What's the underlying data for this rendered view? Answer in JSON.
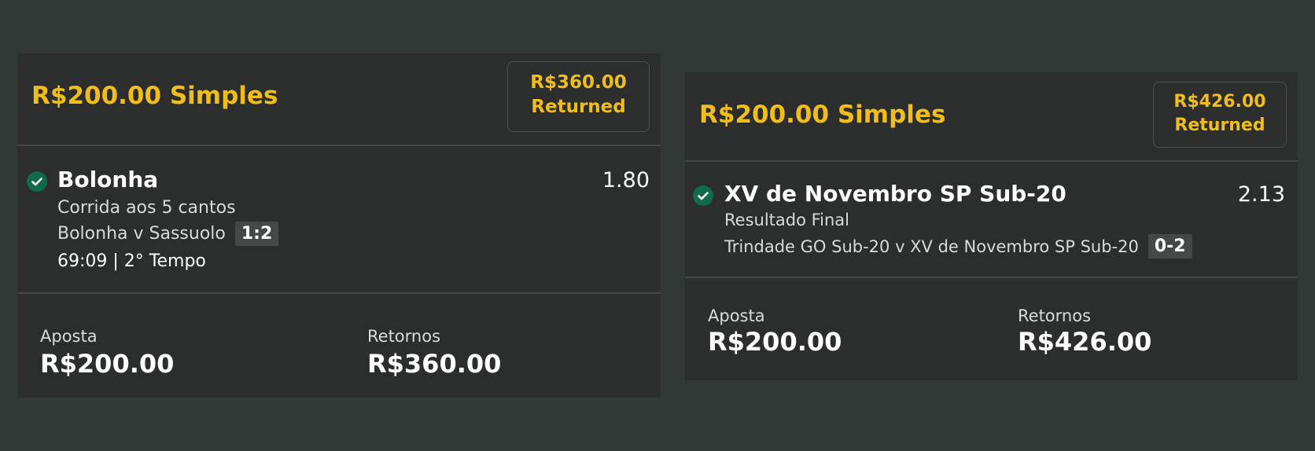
{
  "bets": [
    {
      "title": "R$200.00 Simples",
      "returned_amount": "R$360.00",
      "returned_label": "Returned",
      "selection": "Bolonha",
      "odds": "1.80",
      "market": "Corrida aos 5 cantos",
      "event": "Bolonha v Sassuolo",
      "score": "1:2",
      "timer": "69:09 | 2° Tempo",
      "stake_label": "Aposta",
      "stake_value": "R$200.00",
      "returns_label": "Retornos",
      "returns_value": "R$360.00"
    },
    {
      "title": "R$200.00 Simples",
      "returned_amount": "R$426.00",
      "returned_label": "Returned",
      "selection": "XV de Novembro SP Sub-20",
      "odds": "2.13",
      "market": "Resultado Final",
      "event": "Trindade GO Sub-20 v XV de Novembro SP Sub-20",
      "score": "0-2",
      "stake_label": "Aposta",
      "stake_value": "R$200.00",
      "returns_label": "Retornos",
      "returns_value": "R$426.00"
    }
  ],
  "colors": {
    "accent": "#f1bd18",
    "won_check": "#0f6b4a",
    "background": "#313836",
    "card": "#2b2e2d"
  },
  "icons": {
    "status": "check-circle-icon"
  }
}
